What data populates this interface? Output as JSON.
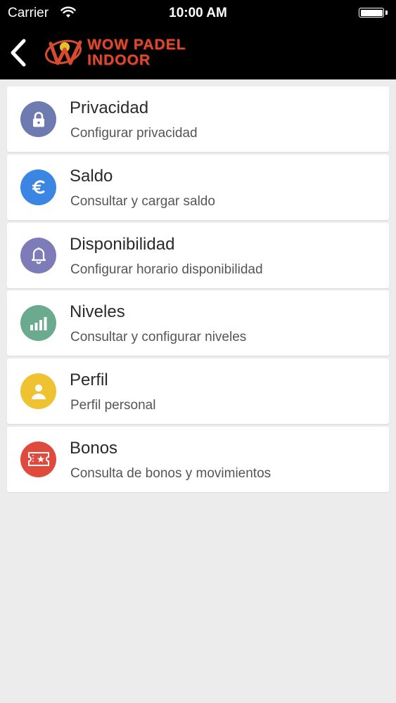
{
  "status_bar": {
    "carrier": "Carrier",
    "time": "10:00 AM"
  },
  "header": {
    "logo_line1": "WOW PADEL",
    "logo_line2": "INDOOR",
    "logo_color": "#d94b2f"
  },
  "menu": {
    "items": [
      {
        "title": "Privacidad",
        "subtitle": "Configurar privacidad",
        "icon": "lock-icon",
        "color": "#6e7bb1"
      },
      {
        "title": "Saldo",
        "subtitle": "Consultar y cargar saldo",
        "icon": "euro-icon",
        "color": "#3b86e2"
      },
      {
        "title": "Disponibilidad",
        "subtitle": "Configurar horario disponibilidad",
        "icon": "bell-icon",
        "color": "#7d7cb9"
      },
      {
        "title": "Niveles",
        "subtitle": "Consultar y configurar niveles",
        "icon": "bar-chart-icon",
        "color": "#6aaa8e"
      },
      {
        "title": "Perfil",
        "subtitle": "Perfil personal",
        "icon": "user-icon",
        "color": "#efc232"
      },
      {
        "title": "Bonos",
        "subtitle": "Consulta de bonos y movimientos",
        "icon": "ticket-icon",
        "color": "#e04a3c"
      }
    ]
  }
}
